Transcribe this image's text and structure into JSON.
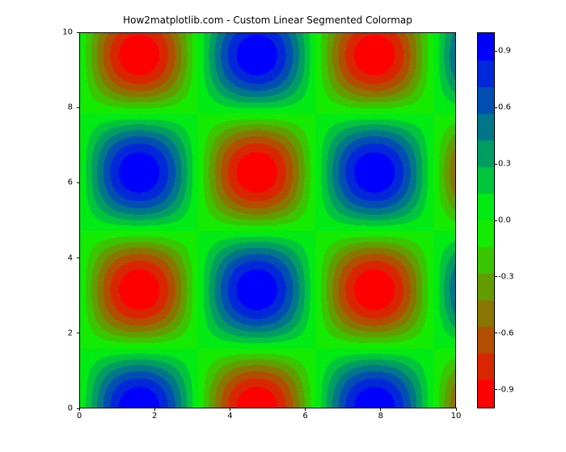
{
  "chart_data": {
    "type": "heatmap",
    "title": "How2matplotlib.com - Custom Linear Segmented Colormap",
    "xlabel": "",
    "ylabel": "",
    "xlim": [
      0,
      10
    ],
    "ylim": [
      0,
      10
    ],
    "xticks": [
      0,
      2,
      4,
      6,
      8,
      10
    ],
    "yticks": [
      0,
      2,
      4,
      6,
      8,
      10
    ],
    "function": "sin(x) * cos(y)",
    "grid_resolution": 100,
    "value_range": [
      -1.0,
      1.0
    ],
    "colormap": {
      "name": "custom_linear_segmented",
      "stops": [
        {
          "pos": 0.0,
          "color": "#ff0000"
        },
        {
          "pos": 0.5,
          "color": "#00ff00"
        },
        {
          "pos": 1.0,
          "color": "#0000ff"
        }
      ]
    },
    "colorbar": {
      "ticks": [
        -0.9,
        -0.6,
        -0.3,
        0.0,
        0.3,
        0.6,
        0.9
      ]
    }
  }
}
